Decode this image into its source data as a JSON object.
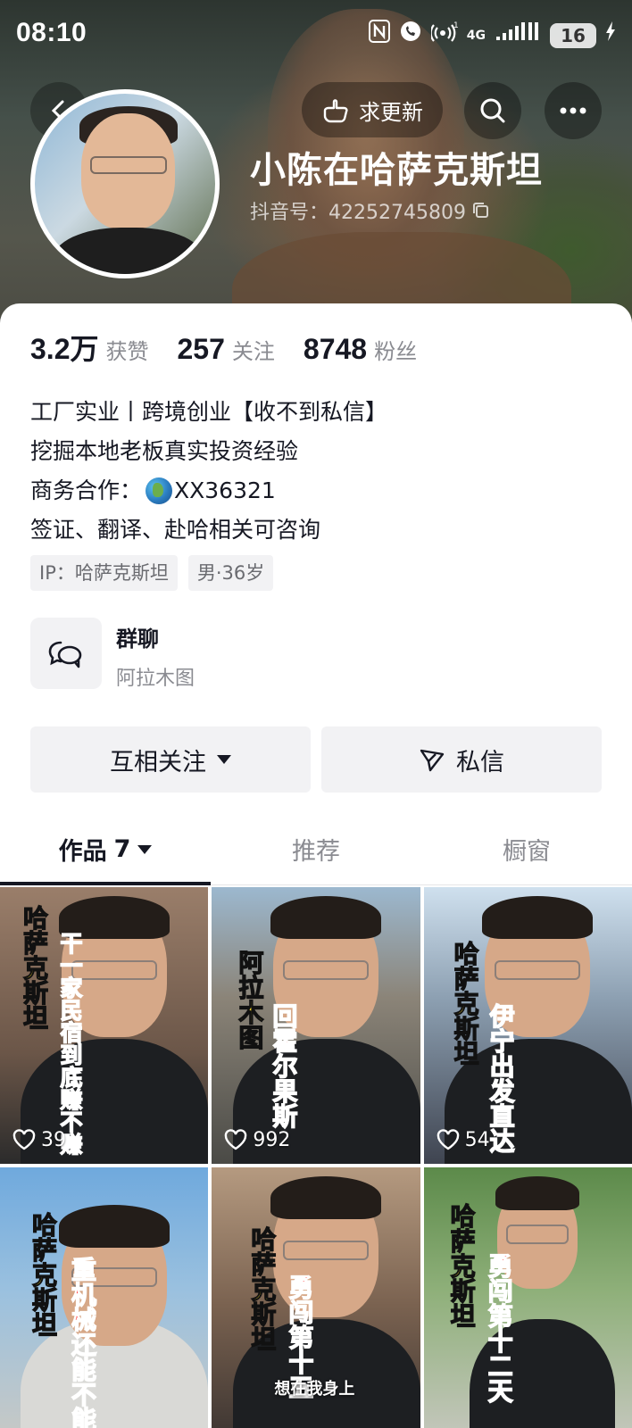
{
  "status_bar": {
    "time": "08:10",
    "network_label": "4G",
    "battery_level": "16"
  },
  "header": {
    "update_button_label": "求更新",
    "nickname": "小陈在哈萨克斯坦",
    "douyin_id": "抖音号：42252745809"
  },
  "stats": [
    {
      "value": "3.2万",
      "label": "获赞"
    },
    {
      "value": "257",
      "label": "关注"
    },
    {
      "value": "8748",
      "label": "粉丝"
    }
  ],
  "bio": {
    "line1": "工厂实业丨跨境创业【收不到私信】",
    "line2": "挖掘本地老板真实投资经验",
    "line3_prefix": "商务合作：",
    "line3_value": "XX36321",
    "line4": "签证、翻译、赴哈相关可咨询"
  },
  "tags": {
    "ip": "IP：哈萨克斯坦",
    "gender_age": "男·36岁"
  },
  "group_chat": {
    "title": "群聊",
    "subtitle": "阿拉木图"
  },
  "actions": {
    "follow_label": "互相关注",
    "message_label": "私信"
  },
  "tabs": {
    "works_label": "作品",
    "works_count": "7",
    "recommend_label": "推荐",
    "showcase_label": "橱窗"
  },
  "videos": [
    {
      "likes": "39",
      "yellow_text": "哈萨克斯坦",
      "red_text": "干一家民宿到底赚不赚"
    },
    {
      "likes": "992",
      "yellow_text": "阿拉木图",
      "red_text": "回霍尔果斯"
    },
    {
      "likes": "54",
      "yellow_text": "哈萨克斯坦",
      "red_text": "伊宁出发直达"
    },
    {
      "likes": "",
      "yellow_text": "哈萨克斯坦",
      "red_text": "重机械还能不能"
    },
    {
      "likes": "",
      "yellow_text": "哈萨克斯坦",
      "red_text": "勇闯第十五",
      "caption": "想在我身上"
    },
    {
      "likes": "",
      "yellow_text": "哈萨克斯坦",
      "red_text": "勇闯第十二天"
    }
  ],
  "colors": {
    "text_primary": "#161823",
    "text_secondary": "#8a8b91",
    "button_bg": "#f2f2f4",
    "overlay_yellow": "#ffe12a",
    "overlay_red": "#ff2d2d"
  }
}
